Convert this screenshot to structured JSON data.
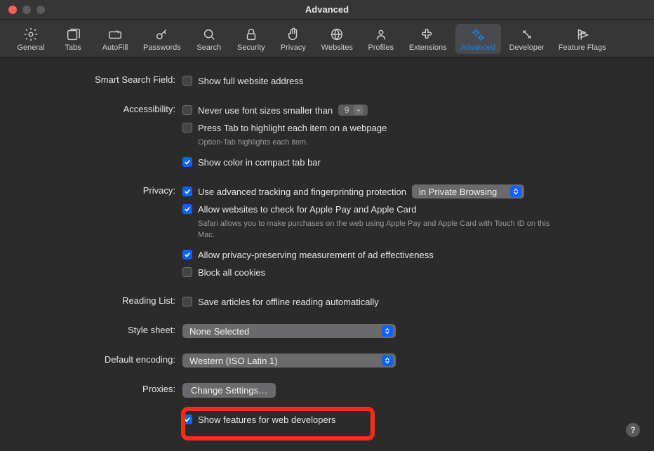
{
  "window": {
    "title": "Advanced"
  },
  "toolbar": {
    "items": [
      {
        "label": "General"
      },
      {
        "label": "Tabs"
      },
      {
        "label": "AutoFill"
      },
      {
        "label": "Passwords"
      },
      {
        "label": "Search"
      },
      {
        "label": "Security"
      },
      {
        "label": "Privacy"
      },
      {
        "label": "Websites"
      },
      {
        "label": "Profiles"
      },
      {
        "label": "Extensions"
      },
      {
        "label": "Advanced"
      },
      {
        "label": "Developer"
      },
      {
        "label": "Feature Flags"
      }
    ]
  },
  "sections": {
    "smartSearch": {
      "label": "Smart Search Field:",
      "showFullAddress": {
        "text": "Show full website address",
        "checked": false
      }
    },
    "accessibility": {
      "label": "Accessibility:",
      "minFont": {
        "text": "Never use font sizes smaller than",
        "checked": false,
        "value": "9"
      },
      "pressTab": {
        "text": "Press Tab to highlight each item on a webpage",
        "checked": false
      },
      "pressTabHint": "Option-Tab highlights each item.",
      "compactColor": {
        "text": "Show color in compact tab bar",
        "checked": true
      }
    },
    "privacy": {
      "label": "Privacy:",
      "tracking": {
        "text": "Use advanced tracking and fingerprinting protection",
        "checked": true,
        "popup": "in Private Browsing"
      },
      "applePay": {
        "text": "Allow websites to check for Apple Pay and Apple Card",
        "checked": true
      },
      "applePayHint": "Safari allows you to make purchases on the web using Apple Pay and Apple Card with Touch ID on this Mac.",
      "adMeasurement": {
        "text": "Allow privacy-preserving measurement of ad effectiveness",
        "checked": true
      },
      "blockCookies": {
        "text": "Block all cookies",
        "checked": false
      }
    },
    "readingList": {
      "label": "Reading List:",
      "saveOffline": {
        "text": "Save articles for offline reading automatically",
        "checked": false
      }
    },
    "styleSheet": {
      "label": "Style sheet:",
      "value": "None Selected"
    },
    "defaultEncoding": {
      "label": "Default encoding:",
      "value": "Western (ISO Latin 1)"
    },
    "proxies": {
      "label": "Proxies:",
      "button": "Change Settings…"
    },
    "developer": {
      "text": "Show features for web developers",
      "checked": true
    }
  },
  "help": "?"
}
